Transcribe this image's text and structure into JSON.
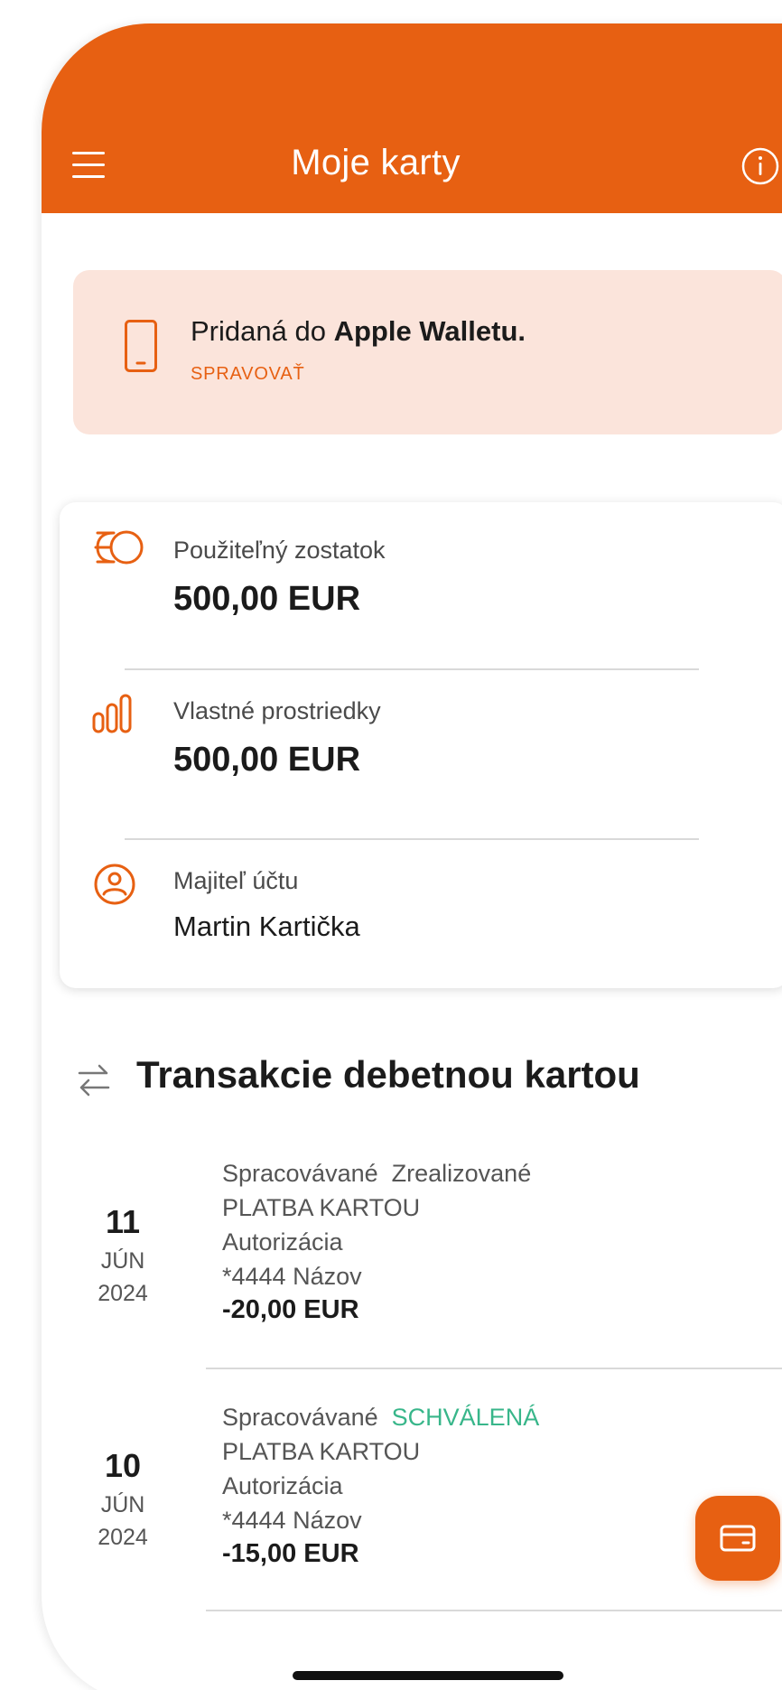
{
  "header": {
    "title": "Moje karty",
    "menu_icon": "hamburger-menu-icon",
    "info_icon": "info-icon",
    "color": "#e76012"
  },
  "wallet_banner": {
    "text_prefix": "Pridaná do",
    "text_bold": "Apple Walletu.",
    "action_label": "SPRAVOVAŤ",
    "icon": "smartphone-icon",
    "background": "#fbe4db"
  },
  "account_card": {
    "available_balance": {
      "icon": "coins-icon",
      "label": "Použiteľný zostatok",
      "value": "500,00 EUR"
    },
    "own_funds": {
      "icon": "bar-chart-icon",
      "label": "Vlastné prostriedky",
      "value": "500,00 EUR"
    },
    "owner": {
      "icon": "user-circle-icon",
      "label": "Majiteľ účtu",
      "value": "Martin Kartička"
    }
  },
  "transactions_section": {
    "icon": "transfer-arrows-icon",
    "title": "Transakcie debetnou kartou"
  },
  "transactions": [
    {
      "day": "11",
      "month": "JÚN",
      "year": "2024",
      "state": "Spracovávané",
      "status": "Zrealizované",
      "status_color": "#555555",
      "type": "PLATBA KARTOU",
      "kind": "Autorizácia",
      "card": "*4444 Názov",
      "amount": "-20,00 EUR"
    },
    {
      "day": "10",
      "month": "JÚN",
      "year": "2024",
      "state": "Spracovávané",
      "status": "SCHVÁLENÁ",
      "status_color": "#38b68a",
      "type": "PLATBA KARTOU",
      "kind": "Autorizácia",
      "card": "*4444 Názov",
      "amount": "-15,00 EUR"
    }
  ],
  "fab": {
    "icon": "credit-card-icon"
  },
  "accent_color": "#e76012"
}
